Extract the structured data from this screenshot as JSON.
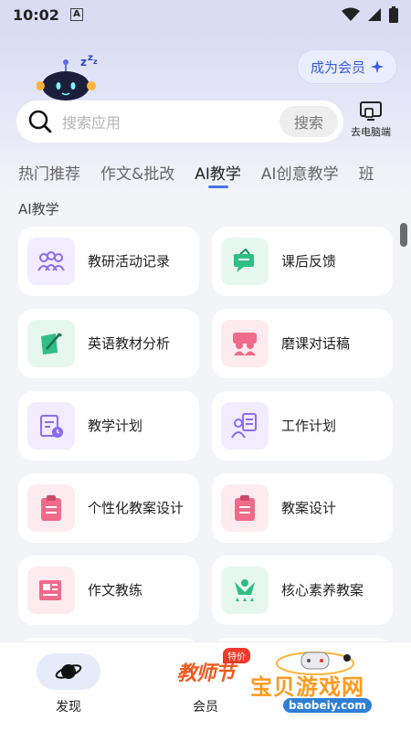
{
  "status_bar": {
    "time": "10:02",
    "notification_badge": "A"
  },
  "header": {
    "vip_button_label": "成为会员",
    "search_placeholder": "搜索应用",
    "search_button_label": "搜索",
    "pc_link_label": "去电脑端"
  },
  "tabs": [
    {
      "label": "热门推荐",
      "active": false
    },
    {
      "label": "作文&批改",
      "active": false
    },
    {
      "label": "AI教学",
      "active": true
    },
    {
      "label": "AI创意教学",
      "active": false
    },
    {
      "label": "班",
      "active": false
    }
  ],
  "section_title": "AI教学",
  "cards": [
    {
      "label": "教研活动记录",
      "icon": "group-icon",
      "icon_color": "#8b6cf0",
      "icon_bg": "#f1ecff"
    },
    {
      "label": "课后反馈",
      "icon": "feedback-icon",
      "icon_color": "#2fbf85",
      "icon_bg": "#e6f7ef"
    },
    {
      "label": "英语教材分析",
      "icon": "book-pen-icon",
      "icon_color": "#2fbf85",
      "icon_bg": "#e6f7ef"
    },
    {
      "label": "磨课对话稿",
      "icon": "dialogue-icon",
      "icon_color": "#f06a8a",
      "icon_bg": "#fdebef"
    },
    {
      "label": "教学计划",
      "icon": "plan-icon",
      "icon_color": "#8b6cf0",
      "icon_bg": "#f1ecff"
    },
    {
      "label": "工作计划",
      "icon": "work-plan-icon",
      "icon_color": "#8b6cf0",
      "icon_bg": "#f1ecff"
    },
    {
      "label": "个性化教案设计",
      "icon": "clipboard-icon",
      "icon_color": "#f06a8a",
      "icon_bg": "#fdebef"
    },
    {
      "label": "教案设计",
      "icon": "clipboard-icon",
      "icon_color": "#f06a8a",
      "icon_bg": "#fdebef"
    },
    {
      "label": "作文教练",
      "icon": "newspaper-icon",
      "icon_color": "#f06a8a",
      "icon_bg": "#fdebef"
    },
    {
      "label": "核心素养教案",
      "icon": "trophy-person-icon",
      "icon_color": "#2fbf85",
      "icon_bg": "#e6f7ef"
    }
  ],
  "bottom_nav": {
    "discover_label": "发现",
    "member_label": "会员",
    "festival_text": "教师节",
    "festival_badge": "特价"
  },
  "watermark": {
    "title": "宝贝游戏网",
    "url": "baobeiy.com"
  }
}
